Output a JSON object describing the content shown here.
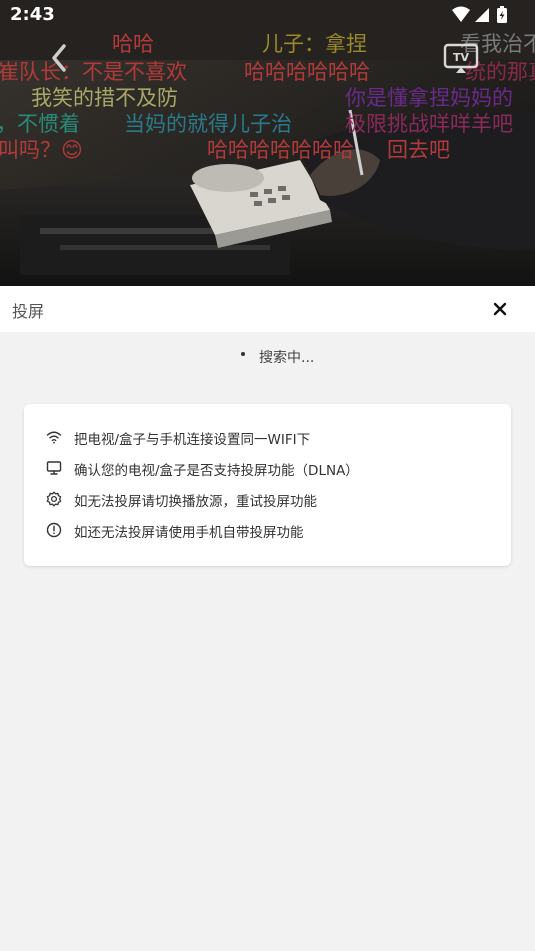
{
  "status_bar": {
    "time": "2:43"
  },
  "danmaku": [
    "哈哈",
    "儿子：拿捏",
    "看我治不",
    "崔队长：不是不喜欢",
    "哈哈哈哈哈哈",
    "统的那真",
    "我笑的措不及防",
    "你是懂拿捏妈妈的",
    "，不惯着",
    "当妈的就得儿子治",
    "极限挑战咩咩羊吧",
    "叫吗？😊",
    "哈哈哈哈哈哈哈",
    "回去吧"
  ],
  "cast_panel": {
    "title": "投屏",
    "searching": "搜索中..."
  },
  "tips": [
    {
      "icon": "wifi-icon",
      "text": "把电视/盒子与手机连接设置同一WIFI下"
    },
    {
      "icon": "monitor-icon",
      "text": "确认您的电视/盒子是否支持投屏功能（DLNA）"
    },
    {
      "icon": "gear-icon",
      "text": "如无法投屏请切换播放源，重试投屏功能"
    },
    {
      "icon": "info-icon",
      "text": "如还无法投屏请使用手机自带投屏功能"
    }
  ]
}
